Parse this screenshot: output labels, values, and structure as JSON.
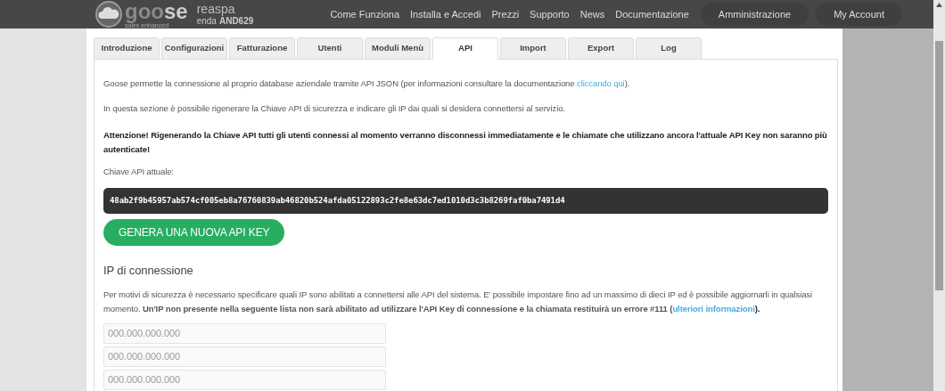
{
  "header": {
    "company_name": "reaspa",
    "company_code_label": "enda",
    "company_code": "AND629",
    "logo_text_light": "goo",
    "logo_text_bold": "se",
    "logo_tagline": "sales enhanced",
    "nav": [
      {
        "label": "Come Funziona",
        "kind": "link"
      },
      {
        "label": "Installa e Accedi",
        "kind": "link"
      },
      {
        "label": "Prezzi",
        "kind": "link"
      },
      {
        "label": "Supporto",
        "kind": "link"
      },
      {
        "label": "News",
        "kind": "link"
      },
      {
        "label": "Documentazione",
        "kind": "link"
      },
      {
        "label": "Amministrazione",
        "kind": "pill"
      },
      {
        "label": "My Account",
        "kind": "pill"
      }
    ]
  },
  "tabs": [
    {
      "label": "Introduzione",
      "selected": false
    },
    {
      "label": "Configurazioni",
      "selected": false
    },
    {
      "label": "Fatturazione",
      "selected": false
    },
    {
      "label": "Utenti",
      "selected": false
    },
    {
      "label": "Moduli Menù",
      "selected": false
    },
    {
      "label": "API",
      "selected": true
    },
    {
      "label": "Import",
      "selected": false
    },
    {
      "label": "Export",
      "selected": false
    },
    {
      "label": "Log",
      "selected": false
    }
  ],
  "intro": {
    "text": "Goose permette la connessione al proprio database aziendale tramite API JSON (per informazioni consultare la documentazione ",
    "link": "cliccando qui",
    "after": ")."
  },
  "section_text": "In questa sezione è possibile rigenerare la Chiave API di sicurezza e indicare gli IP dai quali si desidera connettersi al servizio.",
  "warning": "Attenzione! Rigenerando la Chiave API tutti gli utenti connessi al momento verranno disconnessi immediatamente e le chiamate che utilizzano ancora l'attuale API Key non saranno più autenticate!",
  "api_key_label": "Chiave API attuale:",
  "api_key": "48ab2f9b45957ab574cf005eb8a76760839ab46820b524afda05122893c2fe8e63dc7ed1010d3c3b8269faf0ba7491d4",
  "regenerate_button": "GENERA UNA NUOVA API KEY",
  "ip_section": {
    "title": "IP di connessione",
    "text": "Per motivi di sicurezza è necessario specificare quali IP sono abilitati a connettersi alle API del sistema. E' possibile impostare fino ad un massimo di dieci IP ed è possibile aggiornarli in qualsiasi momento. **Un'IP non presente nella seguente lista non sarà abilitato ad utilizzare l'API Key di connessione e la chiamata restituirà un errore #111 (**",
    "link": "ulteriori informazioni",
    "after": ").",
    "fields": [
      {
        "placeholder": "000.000.000.000"
      },
      {
        "placeholder": "000.000.000.000"
      },
      {
        "placeholder": "000.000.000.000"
      }
    ]
  }
}
